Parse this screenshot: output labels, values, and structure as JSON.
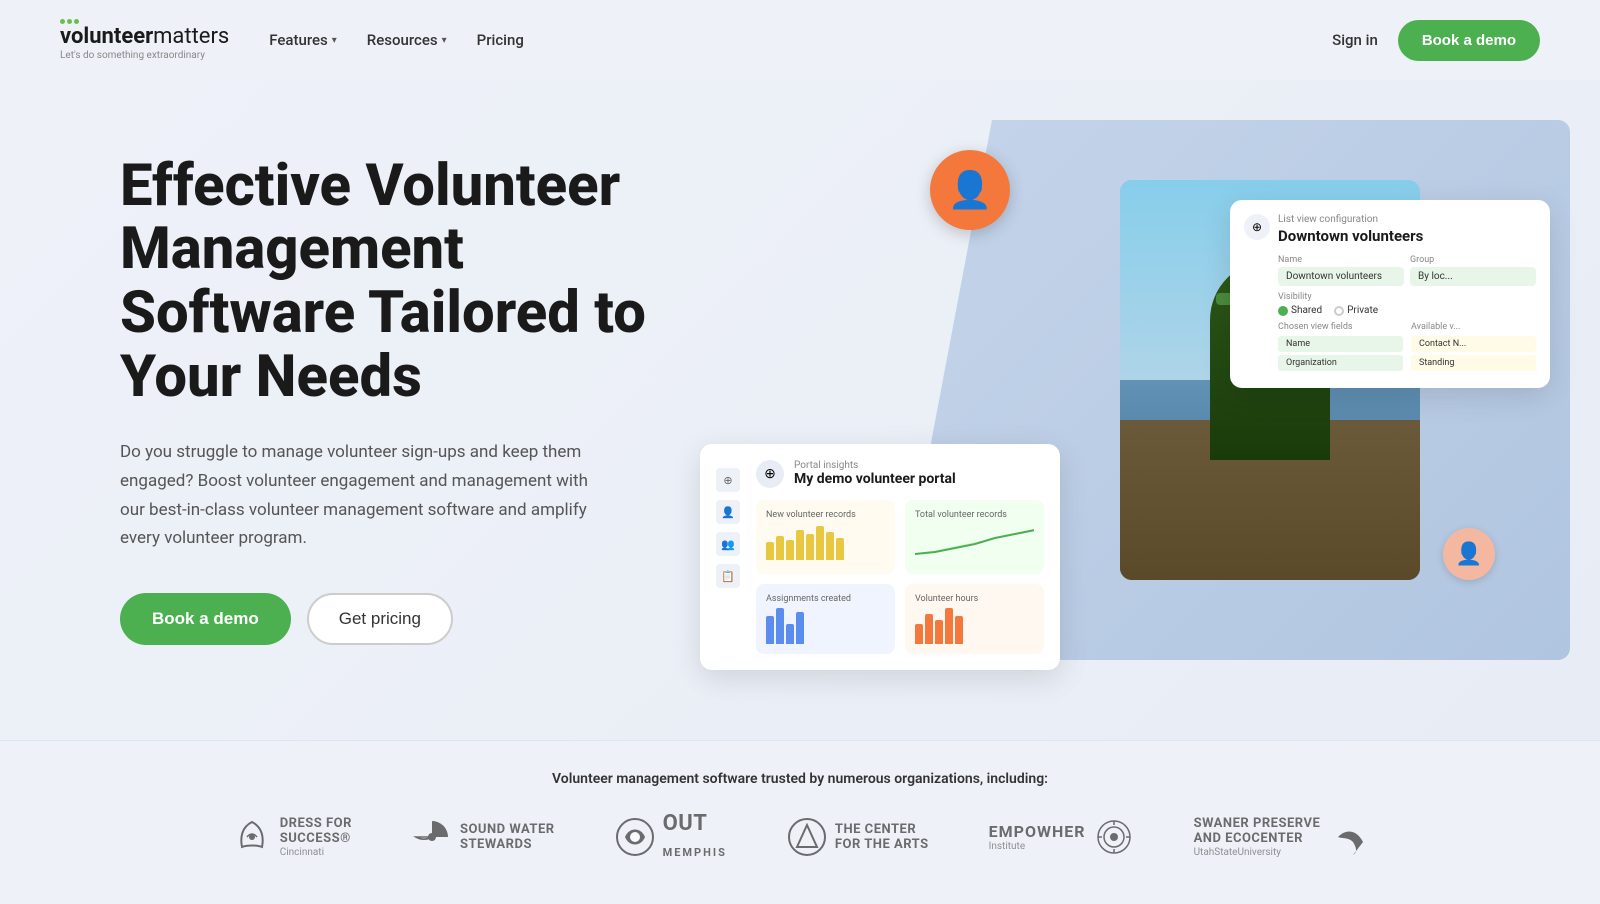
{
  "nav": {
    "logo_bold": "volunteer",
    "logo_light": "matters",
    "logo_tagline": "Let's do something extraordinary",
    "features_label": "Features",
    "resources_label": "Resources",
    "pricing_label": "Pricing",
    "sign_in_label": "Sign in",
    "book_demo_label": "Book a demo"
  },
  "hero": {
    "title": "Effective Volunteer Management Software Tailored to Your Needs",
    "description": "Do you struggle to manage volunteer sign-ups and keep them engaged? Boost volunteer engagement and management with our best-in-class volunteer management software and amplify every volunteer program.",
    "book_demo_label": "Book a demo",
    "get_pricing_label": "Get pricing"
  },
  "portal_card": {
    "subtitle": "Portal insights",
    "title": "My demo volunteer portal",
    "new_volunteers_label": "New volunteer records",
    "total_volunteers_label": "Total volunteer records",
    "assignments_label": "Assignments created",
    "hours_label": "Volunteer hours"
  },
  "list_config": {
    "subtitle": "List view configuration",
    "title": "Downtown volunteers",
    "name_label": "Name",
    "name_value": "Downtown volunteers",
    "group_label": "Group",
    "group_value": "By loc...",
    "visibility_label": "Visibility",
    "shared_label": "Shared",
    "private_label": "Private",
    "chosen_fields_label": "Chosen view fields",
    "available_label": "Available v...",
    "field1": "Name",
    "field2": "Organization",
    "avail1": "Contact N...",
    "avail2": "Standing"
  },
  "trusted": {
    "label": "Volunteer management software trusted by numerous organizations, including:",
    "logos": [
      {
        "name": "DRESS FOR SUCCESS",
        "sub": "Cincinnati",
        "icon": "spiral"
      },
      {
        "name": "SOUND WATER STEWARDS",
        "sub": "",
        "icon": "semicircle"
      },
      {
        "name": "OUT MEMPHIS",
        "sub": "",
        "icon": "swirl"
      },
      {
        "name": "THE CENTER FOR THE ARTS",
        "sub": "",
        "icon": "triangle"
      },
      {
        "name": "EMPOWHER Institute",
        "sub": "",
        "icon": "gear"
      },
      {
        "name": "SWANER PRESERVE AND ECOCENTER",
        "sub": "UtahStateUniversity",
        "icon": "bird"
      }
    ]
  }
}
